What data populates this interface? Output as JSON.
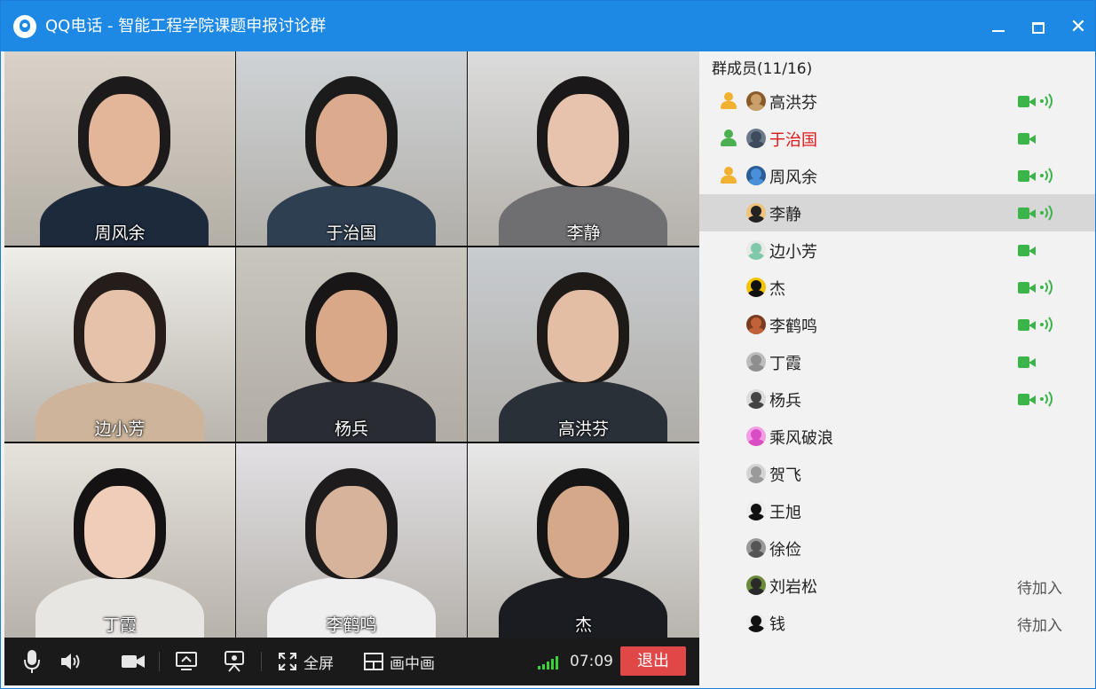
{
  "window": {
    "title": "QQ电话 - 智能工程学院课题申报讨论群",
    "min_label": "minimize",
    "max_label": "maximize",
    "close_symbol": "✕"
  },
  "tiles": [
    {
      "name": "周风余",
      "bg": "#d9d2c8",
      "skin": "#e3b69a",
      "hair": "#1c1a1a",
      "shirt": "#1d2a3c"
    },
    {
      "name": "于治国",
      "bg": "#cfd3d6",
      "skin": "#dcaa8c",
      "hair": "#1b1b1b",
      "shirt": "#2e3f52"
    },
    {
      "name": "李静",
      "bg": "#dcdcdc",
      "skin": "#e7c3ae",
      "hair": "#1a1818",
      "shirt": "#6f6f72"
    },
    {
      "name": "边小芳",
      "bg": "#efede8",
      "skin": "#e6c2aa",
      "hair": "#251d19",
      "shirt": "#cdb49a"
    },
    {
      "name": "杨兵",
      "bg": "#c9c6be",
      "skin": "#d8a889",
      "hair": "#181616",
      "shirt": "#2a2c33"
    },
    {
      "name": "高洪芬",
      "bg": "#c8ccd0",
      "skin": "#e3bda4",
      "hair": "#1e1a18",
      "shirt": "#2a3038"
    },
    {
      "name": "丁霞",
      "bg": "#e6e2dc",
      "skin": "#f0cdb8",
      "hair": "#141212",
      "shirt": "#e8e6e3"
    },
    {
      "name": "李鹤鸣",
      "bg": "#e2e0e4",
      "skin": "#d8b39c",
      "hair": "#1d1b1b",
      "shirt": "#efefef"
    },
    {
      "name": "杰",
      "bg": "#e8e8e8",
      "skin": "#d6a88a",
      "hair": "#151515",
      "shirt": "#1b1c22"
    }
  ],
  "toolbar": {
    "mic_icon": "microphone-icon",
    "speaker_icon": "speaker-icon",
    "camera_icon": "camera-icon",
    "share_icon": "screen-share-icon",
    "record_icon": "record-icon",
    "fullscreen_label": "全屏",
    "pip_label": "画中画",
    "timer": "07:09",
    "quit_label": "退出",
    "signal_color": "#3ad13a",
    "quit_color": "#e04848"
  },
  "members": {
    "header": "群成员(11/16)",
    "list": [
      {
        "name": "高洪芬",
        "role": "admin",
        "video": true,
        "speaking": true,
        "status": "",
        "avatar": [
          "#c9a06a",
          "#8a5a2b"
        ]
      },
      {
        "name": "于治国",
        "role": "admin-green",
        "video": true,
        "speaking": false,
        "status": "",
        "red": true,
        "avatar": [
          "#3d4b5c",
          "#6b7a8a"
        ]
      },
      {
        "name": "周风余",
        "role": "admin",
        "video": true,
        "speaking": true,
        "status": "",
        "avatar": [
          "#4a90d9",
          "#2b5d96"
        ]
      },
      {
        "name": "李静",
        "role": "",
        "video": true,
        "speaking": true,
        "status": "",
        "selected": true,
        "avatar": [
          "#222",
          "#f0c27a"
        ]
      },
      {
        "name": "边小芳",
        "role": "",
        "video": true,
        "speaking": false,
        "status": "",
        "avatar": [
          "#7fc8a9",
          "#e9e9e9"
        ]
      },
      {
        "name": "杰",
        "role": "",
        "video": true,
        "speaking": true,
        "status": "",
        "avatar": [
          "#111",
          "#f5c400"
        ]
      },
      {
        "name": "李鹤鸣",
        "role": "",
        "video": true,
        "speaking": true,
        "status": "",
        "avatar": [
          "#c0623a",
          "#7a3b1f"
        ]
      },
      {
        "name": "丁霞",
        "role": "",
        "video": true,
        "speaking": false,
        "status": "",
        "avatar": [
          "#8e8e8e",
          "#bdbdbd"
        ]
      },
      {
        "name": "杨兵",
        "role": "",
        "video": true,
        "speaking": true,
        "status": "",
        "avatar": [
          "#444",
          "#dcdcdc"
        ]
      },
      {
        "name": "乘风破浪",
        "role": "",
        "video": false,
        "speaking": false,
        "status": "",
        "avatar": [
          "#d94cc4",
          "#f29ee5"
        ]
      },
      {
        "name": "贺飞",
        "role": "",
        "video": false,
        "speaking": false,
        "status": "",
        "avatar": [
          "#9a9a9a",
          "#d4d4d4"
        ]
      },
      {
        "name": "王旭",
        "role": "",
        "video": false,
        "speaking": false,
        "status": "",
        "avatar": [
          "#111",
          "#ededed"
        ]
      },
      {
        "name": "徐俭",
        "role": "",
        "video": false,
        "speaking": false,
        "status": "",
        "avatar": [
          "#555",
          "#999"
        ]
      },
      {
        "name": "刘岩松",
        "role": "",
        "video": false,
        "speaking": false,
        "status": "待加入",
        "avatar": [
          "#2a2a2a",
          "#6a8a3a"
        ]
      },
      {
        "name": "钱",
        "role": "",
        "video": false,
        "speaking": false,
        "status": "待加入",
        "avatar": [
          "#111",
          "#ededed"
        ]
      }
    ]
  }
}
